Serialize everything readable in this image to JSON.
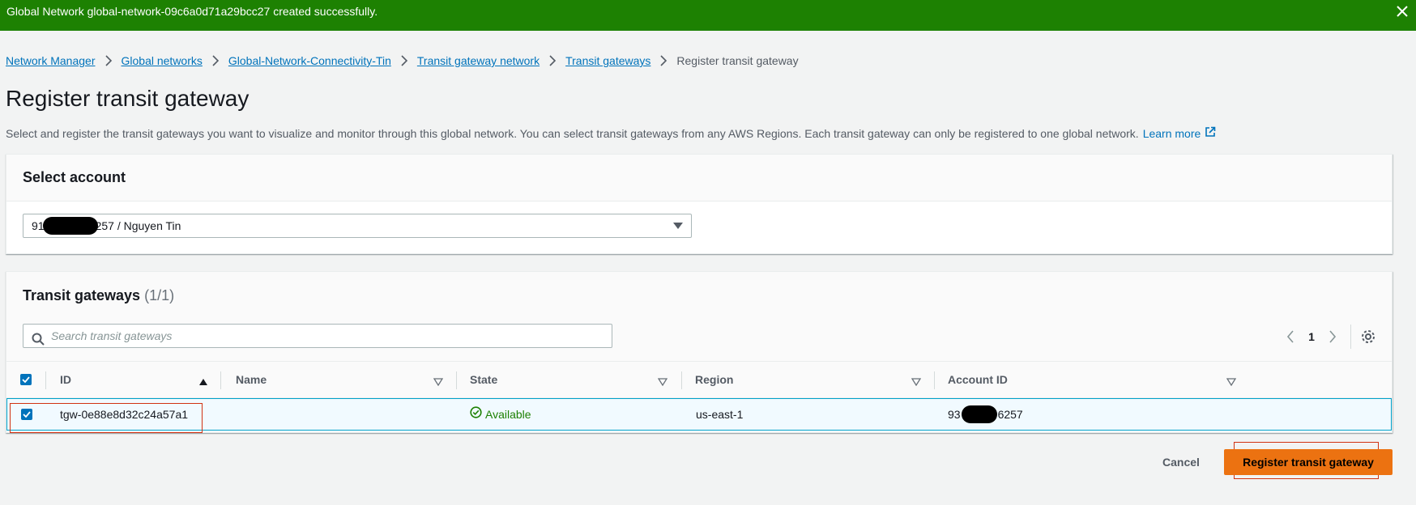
{
  "flash": {
    "message": "Global Network global-network-09c6a0d71a29bcc27 created successfully.",
    "close_icon": "close-icon",
    "color": "#1d8102"
  },
  "breadcrumb": {
    "items": [
      "Network Manager",
      "Global networks",
      "Global-Network-Connectivity-Tin",
      "Transit gateway network",
      "Transit gateways"
    ],
    "current": "Register transit gateway"
  },
  "page": {
    "title": "Register transit gateway",
    "description": "Select and register the transit gateways you want to visualize and monitor through this global network. You can select transit gateways from any AWS Regions. Each transit gateway can only be registered to one global network.",
    "learn_more": "Learn more"
  },
  "account_panel": {
    "title": "Select account",
    "selected_prefix": "91",
    "selected_suffix": "257 / Nguyen Tin"
  },
  "tgw_panel": {
    "title": "Transit gateways",
    "count": "(1/1)",
    "search_placeholder": "Search transit gateways",
    "page_number": "1",
    "columns": [
      "ID",
      "Name",
      "State",
      "Region",
      "Account ID"
    ],
    "rows": [
      {
        "id": "tgw-0e88e8d32c24a57a1",
        "name": "",
        "state": "Available",
        "region": "us-east-1",
        "account_prefix": "93",
        "account_suffix": "6257",
        "selected": true
      }
    ]
  },
  "actions": {
    "cancel": "Cancel",
    "submit": "Register transit gateway",
    "primary_color": "#ec7211"
  }
}
